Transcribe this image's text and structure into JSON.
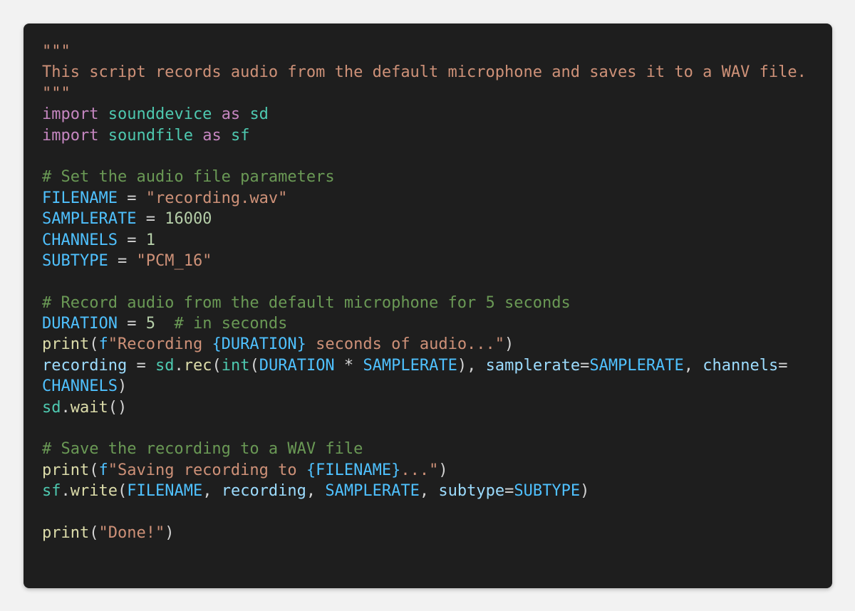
{
  "editor": {
    "theme_colors": {
      "background": "#1e1e1e",
      "page_background": "#f2f2f2",
      "string": "#ce9178",
      "keyword": "#c586c0",
      "module": "#4ec9b0",
      "constant": "#4fc1ff",
      "variable": "#9cdcfe",
      "number": "#b5cea8",
      "comment": "#6a9955",
      "function": "#dcdcaa",
      "plain": "#d4d4d4"
    },
    "lines": [
      [
        {
          "t": "\"\"\"",
          "c": "string"
        }
      ],
      [
        {
          "t": "This script records audio from the default microphone and saves it to a WAV file.",
          "c": "string"
        }
      ],
      [
        {
          "t": "\"\"\"",
          "c": "string"
        }
      ],
      [
        {
          "t": "import",
          "c": "keyword"
        },
        {
          "t": " ",
          "c": "plain"
        },
        {
          "t": "sounddevice",
          "c": "module"
        },
        {
          "t": " ",
          "c": "plain"
        },
        {
          "t": "as",
          "c": "keyword"
        },
        {
          "t": " ",
          "c": "plain"
        },
        {
          "t": "sd",
          "c": "module"
        }
      ],
      [
        {
          "t": "import",
          "c": "keyword"
        },
        {
          "t": " ",
          "c": "plain"
        },
        {
          "t": "soundfile",
          "c": "module"
        },
        {
          "t": " ",
          "c": "plain"
        },
        {
          "t": "as",
          "c": "keyword"
        },
        {
          "t": " ",
          "c": "plain"
        },
        {
          "t": "sf",
          "c": "module"
        }
      ],
      [],
      [
        {
          "t": "# Set the audio file parameters",
          "c": "comment"
        }
      ],
      [
        {
          "t": "FILENAME",
          "c": "constant"
        },
        {
          "t": " = ",
          "c": "plain"
        },
        {
          "t": "\"recording.wav\"",
          "c": "string"
        }
      ],
      [
        {
          "t": "SAMPLERATE",
          "c": "constant"
        },
        {
          "t": " = ",
          "c": "plain"
        },
        {
          "t": "16000",
          "c": "number"
        }
      ],
      [
        {
          "t": "CHANNELS",
          "c": "constant"
        },
        {
          "t": " = ",
          "c": "plain"
        },
        {
          "t": "1",
          "c": "number"
        }
      ],
      [
        {
          "t": "SUBTYPE",
          "c": "constant"
        },
        {
          "t": " = ",
          "c": "plain"
        },
        {
          "t": "\"PCM_16\"",
          "c": "string"
        }
      ],
      [],
      [
        {
          "t": "# Record audio from the default microphone for 5 seconds",
          "c": "comment"
        }
      ],
      [
        {
          "t": "DURATION",
          "c": "constant"
        },
        {
          "t": " = ",
          "c": "plain"
        },
        {
          "t": "5",
          "c": "number"
        },
        {
          "t": "  ",
          "c": "plain"
        },
        {
          "t": "# in seconds",
          "c": "comment"
        }
      ],
      [
        {
          "t": "print",
          "c": "function"
        },
        {
          "t": "(",
          "c": "plain"
        },
        {
          "t": "f",
          "c": "keyword_f"
        },
        {
          "t": "\"Recording ",
          "c": "string"
        },
        {
          "t": "{DURATION}",
          "c": "constant"
        },
        {
          "t": " seconds of audio...\"",
          "c": "string"
        },
        {
          "t": ")",
          "c": "plain"
        }
      ],
      [
        {
          "t": "recording",
          "c": "variable"
        },
        {
          "t": " = ",
          "c": "plain"
        },
        {
          "t": "sd",
          "c": "module"
        },
        {
          "t": ".",
          "c": "plain"
        },
        {
          "t": "rec",
          "c": "function"
        },
        {
          "t": "(",
          "c": "plain"
        },
        {
          "t": "int",
          "c": "module"
        },
        {
          "t": "(",
          "c": "plain"
        },
        {
          "t": "DURATION",
          "c": "constant"
        },
        {
          "t": " * ",
          "c": "plain"
        },
        {
          "t": "SAMPLERATE",
          "c": "constant"
        },
        {
          "t": "), ",
          "c": "plain"
        },
        {
          "t": "samplerate",
          "c": "variable"
        },
        {
          "t": "=",
          "c": "plain"
        },
        {
          "t": "SAMPLERATE",
          "c": "constant"
        },
        {
          "t": ", ",
          "c": "plain"
        },
        {
          "t": "channels",
          "c": "variable"
        },
        {
          "t": "=",
          "c": "plain"
        }
      ],
      [
        {
          "t": "CHANNELS",
          "c": "constant"
        },
        {
          "t": ")",
          "c": "plain"
        }
      ],
      [
        {
          "t": "sd",
          "c": "module"
        },
        {
          "t": ".",
          "c": "plain"
        },
        {
          "t": "wait",
          "c": "function"
        },
        {
          "t": "()",
          "c": "plain"
        }
      ],
      [],
      [
        {
          "t": "# Save the recording to a WAV file",
          "c": "comment"
        }
      ],
      [
        {
          "t": "print",
          "c": "function"
        },
        {
          "t": "(",
          "c": "plain"
        },
        {
          "t": "f",
          "c": "keyword_f"
        },
        {
          "t": "\"Saving recording to ",
          "c": "string"
        },
        {
          "t": "{FILENAME}",
          "c": "constant"
        },
        {
          "t": "...\"",
          "c": "string"
        },
        {
          "t": ")",
          "c": "plain"
        }
      ],
      [
        {
          "t": "sf",
          "c": "module"
        },
        {
          "t": ".",
          "c": "plain"
        },
        {
          "t": "write",
          "c": "function"
        },
        {
          "t": "(",
          "c": "plain"
        },
        {
          "t": "FILENAME",
          "c": "constant"
        },
        {
          "t": ", ",
          "c": "plain"
        },
        {
          "t": "recording",
          "c": "variable"
        },
        {
          "t": ", ",
          "c": "plain"
        },
        {
          "t": "SAMPLERATE",
          "c": "constant"
        },
        {
          "t": ", ",
          "c": "plain"
        },
        {
          "t": "subtype",
          "c": "variable"
        },
        {
          "t": "=",
          "c": "plain"
        },
        {
          "t": "SUBTYPE",
          "c": "constant"
        },
        {
          "t": ")",
          "c": "plain"
        }
      ],
      [],
      [
        {
          "t": "print",
          "c": "function"
        },
        {
          "t": "(",
          "c": "plain"
        },
        {
          "t": "\"Done!\"",
          "c": "string"
        },
        {
          "t": ")",
          "c": "plain"
        }
      ]
    ]
  }
}
